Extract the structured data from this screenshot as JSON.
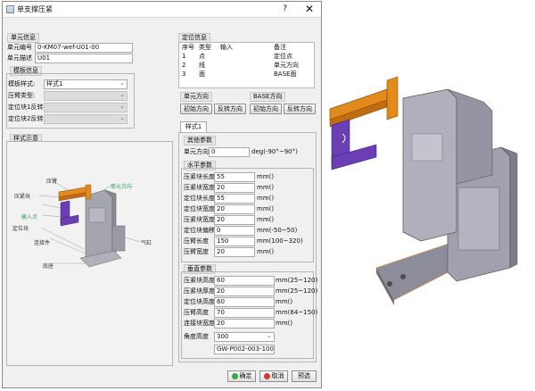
{
  "dialog": {
    "title": "单支撑压紧",
    "help": "?",
    "close": "✕"
  },
  "unit_info": {
    "group_title": "单元信息",
    "code_label": "单元编号",
    "code_value": "0-KM07-wef-U01-00",
    "desc_label": "单元描述",
    "desc_value": "U01"
  },
  "template_info": {
    "group_title": "模板信息",
    "style_label": "模板样式:",
    "style_value": "样式1",
    "clamp_label": "压臂类型:",
    "pin1_label": "定位块1反转:",
    "pin2_label": "定位块2反转:"
  },
  "sample": {
    "group_title": "样式示意"
  },
  "preview_labels": {
    "pressing": "压臂",
    "clamp_block": "压紧块",
    "locator_block": "定位块",
    "input_point": "输入点",
    "base": "底座",
    "connector": "连接件",
    "cylinder": "气缸",
    "unit_dir": "单元方向"
  },
  "locate_info": {
    "group_title": "定位信息",
    "headers": [
      "序号",
      "类型",
      "输入",
      "备注"
    ],
    "rows": [
      {
        "no": "1",
        "type": "点",
        "input": "",
        "note": "定位点"
      },
      {
        "no": "2",
        "type": "线",
        "input": "",
        "note": "单元方向"
      },
      {
        "no": "3",
        "type": "面",
        "input": "",
        "note": "BASE面"
      }
    ]
  },
  "direction": {
    "unit_dir_label": "单元方向",
    "base_dir_label": "BASE方向",
    "init_dir_1": "初始方向",
    "reverse_dir_1": "反转方向",
    "init_dir_2": "初始方向",
    "reverse_dir_2": "反转方向"
  },
  "tab": {
    "label": "样式1"
  },
  "other_params": {
    "group_title": "其他参数",
    "unit_dir_label": "单元方向",
    "unit_dir_value": "0",
    "unit_dir_unit": "deg(-90°~90°)"
  },
  "horizontal": {
    "group_title": "水平参数",
    "rows": [
      {
        "label": "压紧块长度",
        "value": "55",
        "unit": "mm()"
      },
      {
        "label": "压紧块宽度",
        "value": "20",
        "unit": "mm()"
      },
      {
        "label": "定位块长度",
        "value": "55",
        "unit": "mm()"
      },
      {
        "label": "定位块宽度",
        "value": "20",
        "unit": "mm()"
      },
      {
        "label": "压紧块宽度",
        "value": "20",
        "unit": "mm()"
      },
      {
        "label": "定位块偏移",
        "value": "0",
        "unit": "mm(-50~50)"
      },
      {
        "label": "压臂长度",
        "value": "150",
        "unit": "mm(100~320)"
      },
      {
        "label": "压臂宽度",
        "value": "20",
        "unit": "mm()"
      }
    ]
  },
  "vertical": {
    "group_title": "垂直参数",
    "rows": [
      {
        "label": "压紧块高度",
        "value": "60",
        "unit": "mm(25~120)"
      },
      {
        "label": "压紧块厚度",
        "value": "20",
        "unit": "mm(25~120)"
      },
      {
        "label": "定位块高度",
        "value": "60",
        "unit": "mm()"
      },
      {
        "label": "压臂高度",
        "value": "70",
        "unit": "mm(64~150)"
      },
      {
        "label": "连接块宽度",
        "value": "20",
        "unit": "mm()"
      }
    ],
    "angle_label": "角度高度",
    "angle_value": "300",
    "part_code": "GW-P002-003-100A"
  },
  "footer": {
    "ok": "确定",
    "cancel": "取消",
    "preview": "预选"
  },
  "colors": {
    "ok_dot": "#3aa64a",
    "cancel_dot": "#d23a2a",
    "clamp_orange": "#e38a1d",
    "locator_purple": "#6a3fb4",
    "body_gray": "#9a9aa6"
  }
}
